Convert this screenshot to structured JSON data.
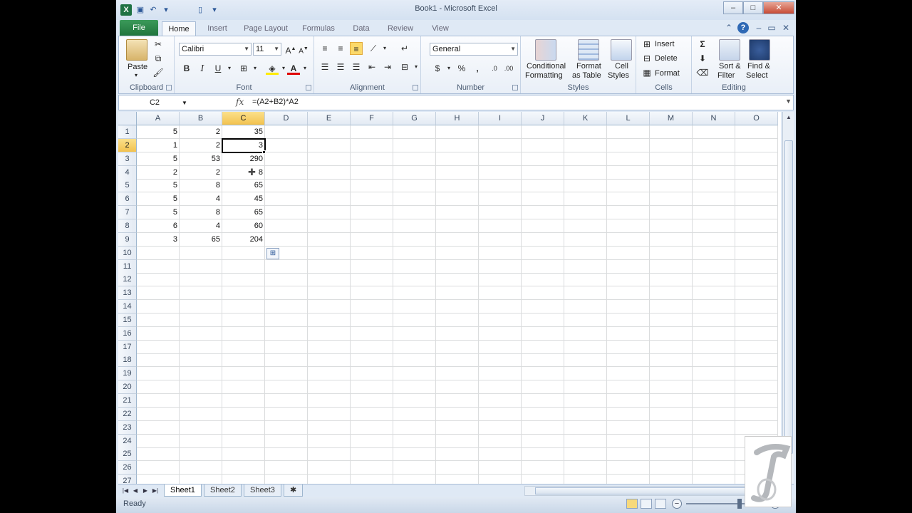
{
  "window": {
    "title": "Book1 - Microsoft Excel"
  },
  "tabs": {
    "file": "File",
    "home": "Home",
    "insert": "Insert",
    "page_layout": "Page Layout",
    "formulas": "Formulas",
    "data": "Data",
    "review": "Review",
    "view": "View"
  },
  "ribbon": {
    "clipboard": {
      "label": "Clipboard",
      "paste": "Paste"
    },
    "font": {
      "label": "Font",
      "name": "Calibri",
      "size": "11",
      "bold": "B",
      "italic": "I",
      "underline": "U"
    },
    "alignment": {
      "label": "Alignment"
    },
    "number": {
      "label": "Number",
      "format": "General",
      "percent": "%",
      "comma": ","
    },
    "styles": {
      "label": "Styles",
      "conditional_1": "Conditional",
      "conditional_2": "Formatting",
      "format_table_1": "Format",
      "format_table_2": "as Table",
      "cell_styles_1": "Cell",
      "cell_styles_2": "Styles"
    },
    "cells": {
      "label": "Cells",
      "insert": "Insert",
      "delete": "Delete",
      "format": "Format"
    },
    "editing": {
      "label": "Editing",
      "sort_1": "Sort &",
      "sort_2": "Filter",
      "find_1": "Find &",
      "find_2": "Select"
    }
  },
  "formula_bar": {
    "name_box": "C2",
    "fx": "fx",
    "formula": "=(A2+B2)*A2"
  },
  "grid": {
    "columns": [
      "A",
      "B",
      "C",
      "D",
      "E",
      "F",
      "G",
      "H",
      "I",
      "J",
      "K",
      "L",
      "M",
      "N",
      "O"
    ],
    "selected_column": "C",
    "selected_row": 2,
    "rows": [
      {
        "n": "1",
        "A": "5",
        "B": "2",
        "C": "35"
      },
      {
        "n": "2",
        "A": "1",
        "B": "2",
        "C": "3"
      },
      {
        "n": "3",
        "A": "5",
        "B": "53",
        "C": "290"
      },
      {
        "n": "4",
        "A": "2",
        "B": "2",
        "C": "8"
      },
      {
        "n": "5",
        "A": "5",
        "B": "8",
        "C": "65"
      },
      {
        "n": "6",
        "A": "5",
        "B": "4",
        "C": "45"
      },
      {
        "n": "7",
        "A": "5",
        "B": "8",
        "C": "65"
      },
      {
        "n": "8",
        "A": "6",
        "B": "4",
        "C": "60"
      },
      {
        "n": "9",
        "A": "3",
        "B": "65",
        "C": "204"
      },
      {
        "n": "10"
      },
      {
        "n": "11"
      },
      {
        "n": "12"
      },
      {
        "n": "13"
      },
      {
        "n": "14"
      },
      {
        "n": "15"
      },
      {
        "n": "16"
      },
      {
        "n": "17"
      },
      {
        "n": "18"
      },
      {
        "n": "19"
      },
      {
        "n": "20"
      },
      {
        "n": "21"
      },
      {
        "n": "22"
      },
      {
        "n": "23"
      },
      {
        "n": "24"
      },
      {
        "n": "25"
      },
      {
        "n": "26"
      },
      {
        "n": "27"
      }
    ]
  },
  "sheets": [
    "Sheet1",
    "Sheet2",
    "Sheet3"
  ],
  "active_sheet": "Sheet1",
  "status": {
    "text": "Ready"
  },
  "colors": {
    "file_tab": "#21753d",
    "selection_header": "#f2c24f",
    "accent": "#2b5797"
  }
}
